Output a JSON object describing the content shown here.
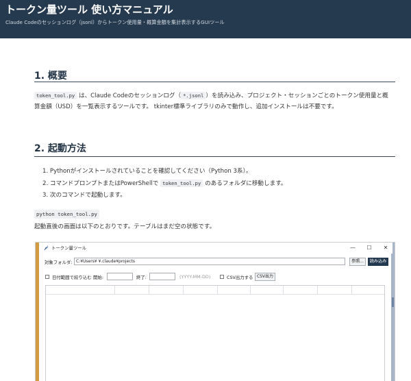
{
  "header": {
    "title": "トークン量ツール 使い方マニュアル",
    "subtitle": "Claude Codeのセッションログ（jsonl）からトークン使用量・概算金額を集計表示するGUIツール"
  },
  "section1": {
    "heading": "1. 概要",
    "code1": "token_tool.py",
    "text1": " は、Claude Codeのセッションログ（",
    "code2": "*.jsonl",
    "text2": "）を読み込み、プロジェクト・セッションごとのトークン使用量と概算金額（USD）を一覧表示するツールです。 tkinter標準ライブラリのみで動作し、追加インストールは不要です。"
  },
  "section2": {
    "heading": "2. 起動方法",
    "step1": "1. Pythonがインストールされていることを確認してください（Python 3系）。",
    "step2_a": "2. コマンドプロンプトまたはPowerShellで ",
    "step2_code": "token_tool.py",
    "step2_b": " のあるフォルダに移動します。",
    "step3": "3. 次のコマンドで起動します。",
    "command": "python token_tool.py",
    "after_text": "起動直後の画面は以下のとおりです。テーブルはまだ空の状態です。"
  },
  "app": {
    "window_title": "トークン量ツール",
    "min_glyph": "—",
    "max_glyph": "☐",
    "close_glyph": "✕",
    "folder_label": "対象フォルダ:",
    "folder_value": "C:¥Users¥           ¥.claude¥projects",
    "browse_label": "参照...",
    "load_label": "読み込み",
    "date_filter_label": "日付範囲で絞り込む",
    "start_label": "開始:",
    "end_label": "終了:",
    "date_hint": "(YYYY-MM-DD)",
    "csv_check_label": "CSV出力する",
    "csv_button_label": "CSV出力"
  },
  "colors": {
    "header_bg": "#263a4f",
    "accent": "#22384e"
  }
}
